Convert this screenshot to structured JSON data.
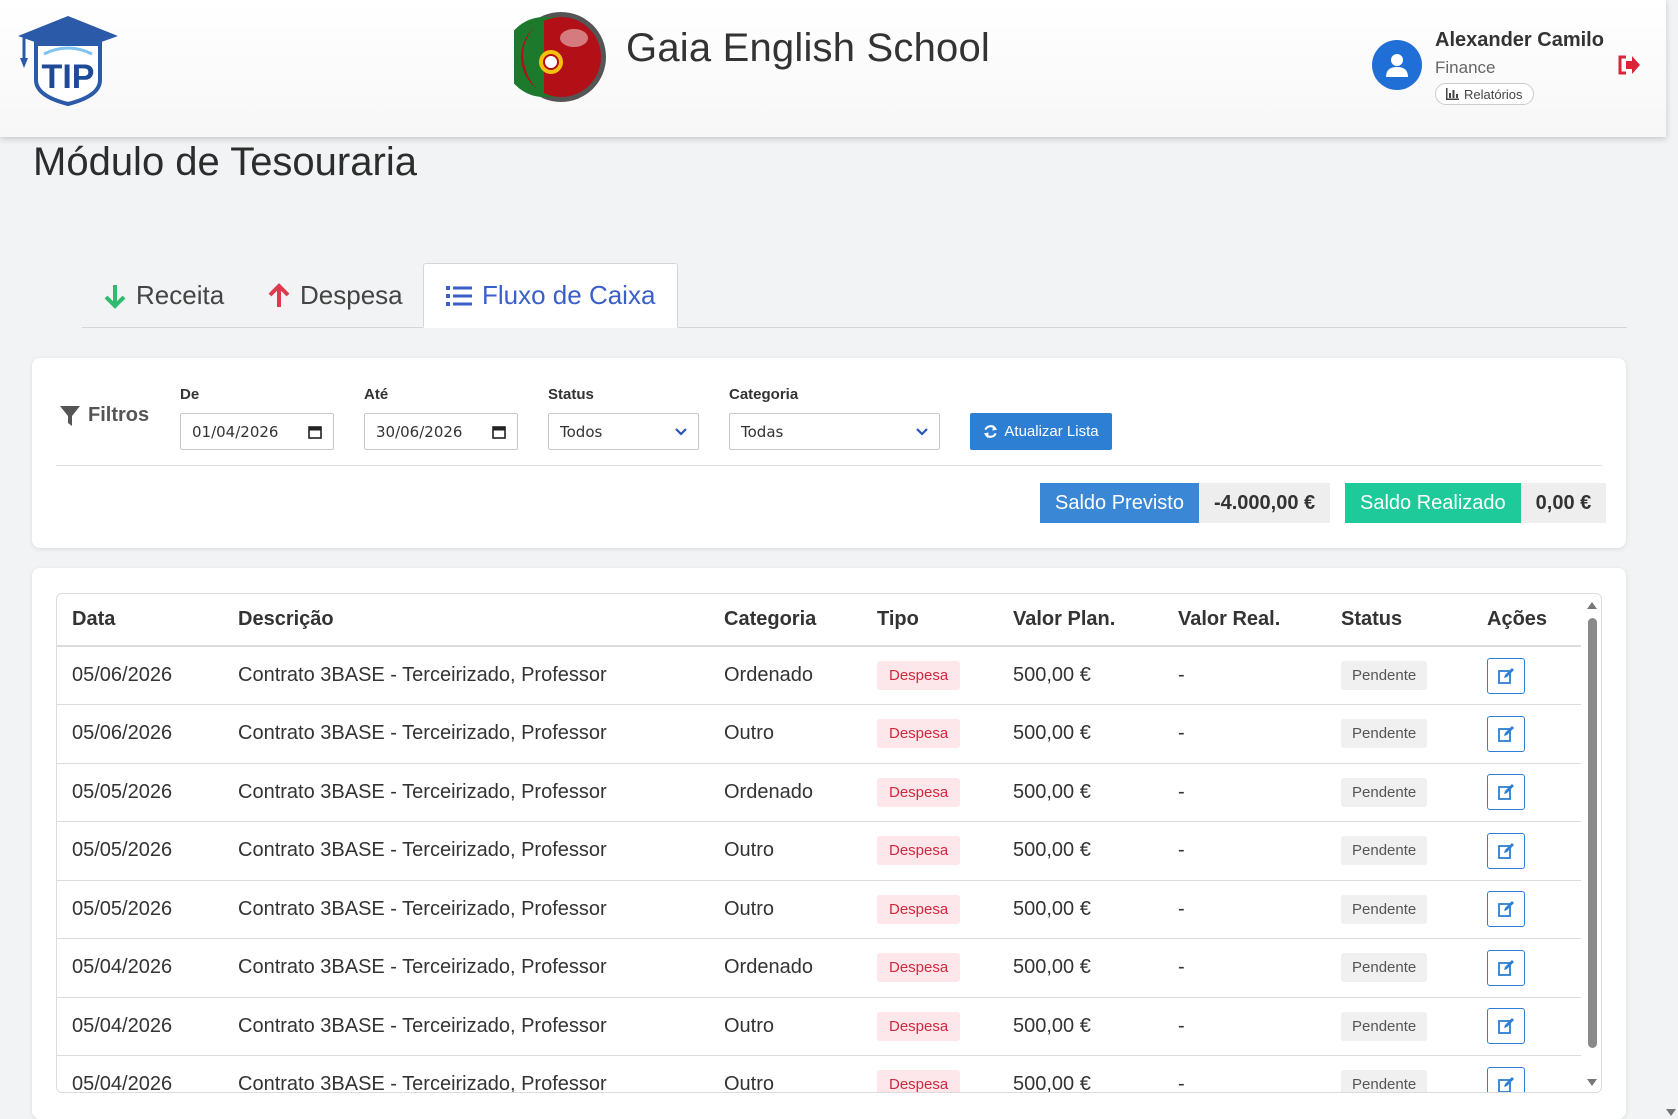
{
  "header": {
    "school_name": "Gaia English School",
    "logo_text": "TIP",
    "user": {
      "name": "Alexander Camilo",
      "role": "Finance",
      "reports_label": "Relatórios"
    }
  },
  "page": {
    "title": "Módulo de Tesouraria"
  },
  "tabs": [
    {
      "label": "Receita",
      "icon": "arrow-down-icon",
      "active": false
    },
    {
      "label": "Despesa",
      "icon": "arrow-up-icon",
      "active": false
    },
    {
      "label": "Fluxo de Caixa",
      "icon": "list-icon",
      "active": true
    }
  ],
  "filters": {
    "title": "Filtros",
    "from_label": "De",
    "from_value": "01/04/2026",
    "to_label": "Até",
    "to_value": "30/06/2026",
    "status_label": "Status",
    "status_value": "Todos",
    "category_label": "Categoria",
    "category_value": "Todas",
    "refresh_label": "Atualizar Lista"
  },
  "balances": {
    "planned_label": "Saldo Previsto",
    "planned_value": "-4.000,00 €",
    "realized_label": "Saldo Realizado",
    "realized_value": "0,00 €"
  },
  "colors": {
    "primary": "#3a87d6",
    "success": "#1ec99a",
    "danger": "#d0283f",
    "accent_tab": "#3a5fc8"
  },
  "table": {
    "columns": [
      "Data",
      "Descrição",
      "Categoria",
      "Tipo",
      "Valor Plan.",
      "Valor Real.",
      "Status",
      "Ações"
    ],
    "rows": [
      {
        "date": "05/06/2026",
        "description": "Contrato 3BASE - Terceirizado, Professor",
        "category": "Ordenado",
        "type": "Despesa",
        "planned": "500,00 €",
        "real": "-",
        "status": "Pendente"
      },
      {
        "date": "05/06/2026",
        "description": "Contrato 3BASE - Terceirizado, Professor",
        "category": "Outro",
        "type": "Despesa",
        "planned": "500,00 €",
        "real": "-",
        "status": "Pendente"
      },
      {
        "date": "05/05/2026",
        "description": "Contrato 3BASE - Terceirizado, Professor",
        "category": "Ordenado",
        "type": "Despesa",
        "planned": "500,00 €",
        "real": "-",
        "status": "Pendente"
      },
      {
        "date": "05/05/2026",
        "description": "Contrato 3BASE - Terceirizado, Professor",
        "category": "Outro",
        "type": "Despesa",
        "planned": "500,00 €",
        "real": "-",
        "status": "Pendente"
      },
      {
        "date": "05/05/2026",
        "description": "Contrato 3BASE - Terceirizado, Professor",
        "category": "Outro",
        "type": "Despesa",
        "planned": "500,00 €",
        "real": "-",
        "status": "Pendente"
      },
      {
        "date": "05/04/2026",
        "description": "Contrato 3BASE - Terceirizado, Professor",
        "category": "Ordenado",
        "type": "Despesa",
        "planned": "500,00 €",
        "real": "-",
        "status": "Pendente"
      },
      {
        "date": "05/04/2026",
        "description": "Contrato 3BASE - Terceirizado, Professor",
        "category": "Outro",
        "type": "Despesa",
        "planned": "500,00 €",
        "real": "-",
        "status": "Pendente"
      },
      {
        "date": "05/04/2026",
        "description": "Contrato 3BASE - Terceirizado, Professor",
        "category": "Outro",
        "type": "Despesa",
        "planned": "500,00 €",
        "real": "-",
        "status": "Pendente"
      }
    ]
  }
}
